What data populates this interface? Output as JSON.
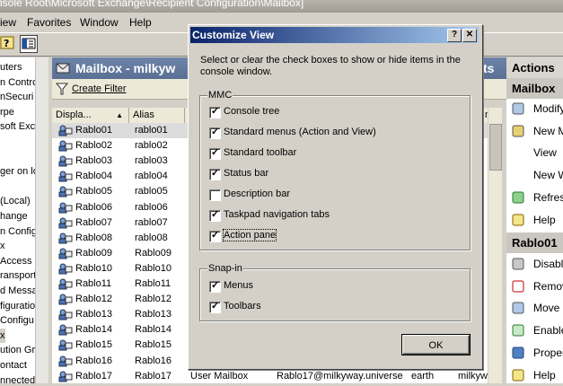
{
  "window": {
    "title": "nsole Root\\Microsoft Exchange\\Recipient Configuration\\Mailbox]"
  },
  "menu": {
    "items": [
      "iew",
      "Favorites",
      "Window",
      "Help"
    ]
  },
  "tree": {
    "items": [
      "uters",
      "n Contro",
      "nSecuri",
      "rpe",
      "soft Exch",
      "",
      "",
      "ger on loc",
      "",
      "(Local)",
      "hange",
      "n Configu",
      "x",
      "Access",
      "ransport",
      "d Messag",
      "figuration",
      "Configu",
      "x",
      "ution Gro",
      "ontact",
      "nnected"
    ]
  },
  "mailbox": {
    "title": "Mailbox - milkyw",
    "title_suffix": "ts",
    "filter_label": "Create Filter",
    "columns": [
      "Displa...",
      "Alias",
      "",
      "",
      ""
    ],
    "rows": [
      {
        "name": "Rablo01",
        "alias": "rablo01"
      },
      {
        "name": "Rablo02",
        "alias": "rablo02"
      },
      {
        "name": "Rablo03",
        "alias": "rablo03"
      },
      {
        "name": "Rablo04",
        "alias": "rablo04"
      },
      {
        "name": "Rablo05",
        "alias": "rablo05"
      },
      {
        "name": "Rablo06",
        "alias": "rablo06"
      },
      {
        "name": "Rablo07",
        "alias": "rablo07"
      },
      {
        "name": "Rablo08",
        "alias": "rablo08"
      },
      {
        "name": "Rablo09",
        "alias": "Rablo09"
      },
      {
        "name": "Rablo10",
        "alias": "Rablo10"
      },
      {
        "name": "Rablo11",
        "alias": "Rablo11"
      },
      {
        "name": "Rablo12",
        "alias": "Rablo12"
      },
      {
        "name": "Rablo13",
        "alias": "Rablo13"
      },
      {
        "name": "Rablo14",
        "alias": "Rablo14"
      },
      {
        "name": "Rablo15",
        "alias": "Rablo15"
      },
      {
        "name": "Rablo16",
        "alias": "Rablo16"
      },
      {
        "name": "Rablo17",
        "alias": "Rablo17",
        "type": "User Mailbox",
        "email": "Rablo17@milkyway.universe",
        "server": "earth",
        "extra": "milkyw"
      }
    ],
    "header_col3": "mi"
  },
  "actions": {
    "title": "Actions",
    "section1": "Mailbox",
    "items1": [
      "Modify",
      "New M",
      "View",
      "New W",
      "Refresh",
      "Help"
    ],
    "section2": "Rablo01",
    "items2": [
      "Disable",
      "Remov",
      "Move M",
      "Enable",
      "Proper",
      "Help"
    ]
  },
  "dialog": {
    "title": "Customize View",
    "help_btn": "?",
    "close_btn": "✕",
    "description": "Select or clear the check boxes to show or hide items in the console window.",
    "mmc_label": "MMC",
    "mmc_options": [
      {
        "label": "Console tree",
        "checked": true
      },
      {
        "label": "Standard menus (Action and View)",
        "checked": true
      },
      {
        "label": "Standard toolbar",
        "checked": true
      },
      {
        "label": "Status bar",
        "checked": true
      },
      {
        "label": "Description bar",
        "checked": false
      },
      {
        "label": "Taskpad navigation tabs",
        "checked": true
      },
      {
        "label": "Action pane",
        "checked": true
      }
    ],
    "snapin_label": "Snap-in",
    "snapin_options": [
      {
        "label": "Menus",
        "checked": true
      },
      {
        "label": "Toolbars",
        "checked": true
      }
    ],
    "ok_label": "OK"
  }
}
